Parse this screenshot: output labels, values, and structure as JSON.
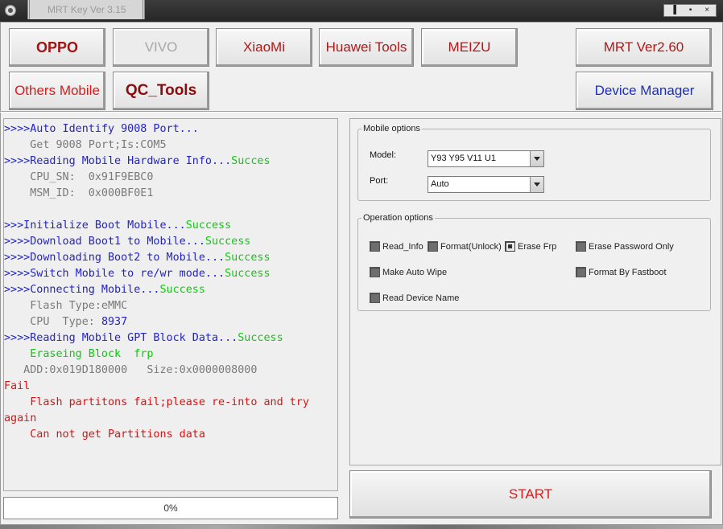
{
  "window": {
    "title": "MRT Key Ver 3.15",
    "controls": [
      "▐",
      "▪",
      "×"
    ]
  },
  "top_buttons": {
    "oppo": "OPPO",
    "vivo": "VIVO",
    "xiaomi": "XiaoMi",
    "huawei": "Huawei Tools",
    "meizu": "MEIZU",
    "mrt": "MRT Ver2.60",
    "others": "Others Mobile",
    "qc_tools": "QC_Tools",
    "device_manager": "Device Manager"
  },
  "log": [
    [
      {
        "t": ">>>>Auto Identify 9008 Port...",
        "c": "blue"
      }
    ],
    [
      {
        "t": "    Get 9008 Port;Is:COM5",
        "c": "gray"
      }
    ],
    [
      {
        "t": ">>>>Reading Mobile Hardware Info...",
        "c": "blue"
      },
      {
        "t": "Succes",
        "c": "green"
      }
    ],
    [
      {
        "t": "    CPU_SN:  0x91F9EBC0",
        "c": "gray"
      }
    ],
    [
      {
        "t": "    MSM_ID:  0x000BF0E1",
        "c": "gray"
      }
    ],
    [
      {
        "t": "",
        "c": "gray"
      }
    ],
    [
      {
        "t": ">>>Initialize Boot Mobile...",
        "c": "blue"
      },
      {
        "t": "Success",
        "c": "green"
      }
    ],
    [
      {
        "t": ">>>>Download Boot1 to Mobile...",
        "c": "blue"
      },
      {
        "t": "Success",
        "c": "green"
      }
    ],
    [
      {
        "t": ">>>>Downloading Boot2 to Mobile...",
        "c": "blue"
      },
      {
        "t": "Success",
        "c": "green"
      }
    ],
    [
      {
        "t": ">>>>Switch Mobile to re/wr mode...",
        "c": "blue"
      },
      {
        "t": "Success",
        "c": "green"
      }
    ],
    [
      {
        "t": ">>>>Connecting Mobile...",
        "c": "blue"
      },
      {
        "t": "Success",
        "c": "green"
      }
    ],
    [
      {
        "t": "    Flash Type:eMMC",
        "c": "gray"
      }
    ],
    [
      {
        "t": "    CPU  Type: ",
        "c": "gray"
      },
      {
        "t": "8937",
        "c": "blue"
      }
    ],
    [
      {
        "t": ">>>>Reading Mobile GPT Block Data...",
        "c": "blue"
      },
      {
        "t": "Success",
        "c": "green"
      }
    ],
    [
      {
        "t": "    Eraseing Block  frp",
        "c": "green"
      }
    ],
    [
      {
        "t": "   ADD:0x019D180000   Size:0x0000008000",
        "c": "gray"
      }
    ],
    [
      {
        "t": "Fail",
        "c": "red"
      }
    ],
    [
      {
        "t": "    Flash partitons fail;please re-into and try",
        "c": "red"
      }
    ],
    [
      {
        "t": "again",
        "c": "red"
      }
    ],
    [
      {
        "t": "    Can not get Partitions data",
        "c": "red"
      }
    ]
  ],
  "progress": {
    "value": 0,
    "label": "0%"
  },
  "mobile_options": {
    "legend": "Mobile options",
    "model_label": "Model:",
    "model_value": "Y93 Y95 V11 U1",
    "port_label": "Port:",
    "port_value": "Auto"
  },
  "operation_options": {
    "legend": "Operation options",
    "read_info": "Read_Info",
    "format_unlock": "Format(Unlock)",
    "erase_frp": "Erase Frp",
    "erase_password": "Erase Password Only",
    "make_auto_wipe": "Make Auto Wipe",
    "format_fastboot": "Format By Fastboot",
    "read_device_name": "Read Device Name"
  },
  "start_label": "START"
}
